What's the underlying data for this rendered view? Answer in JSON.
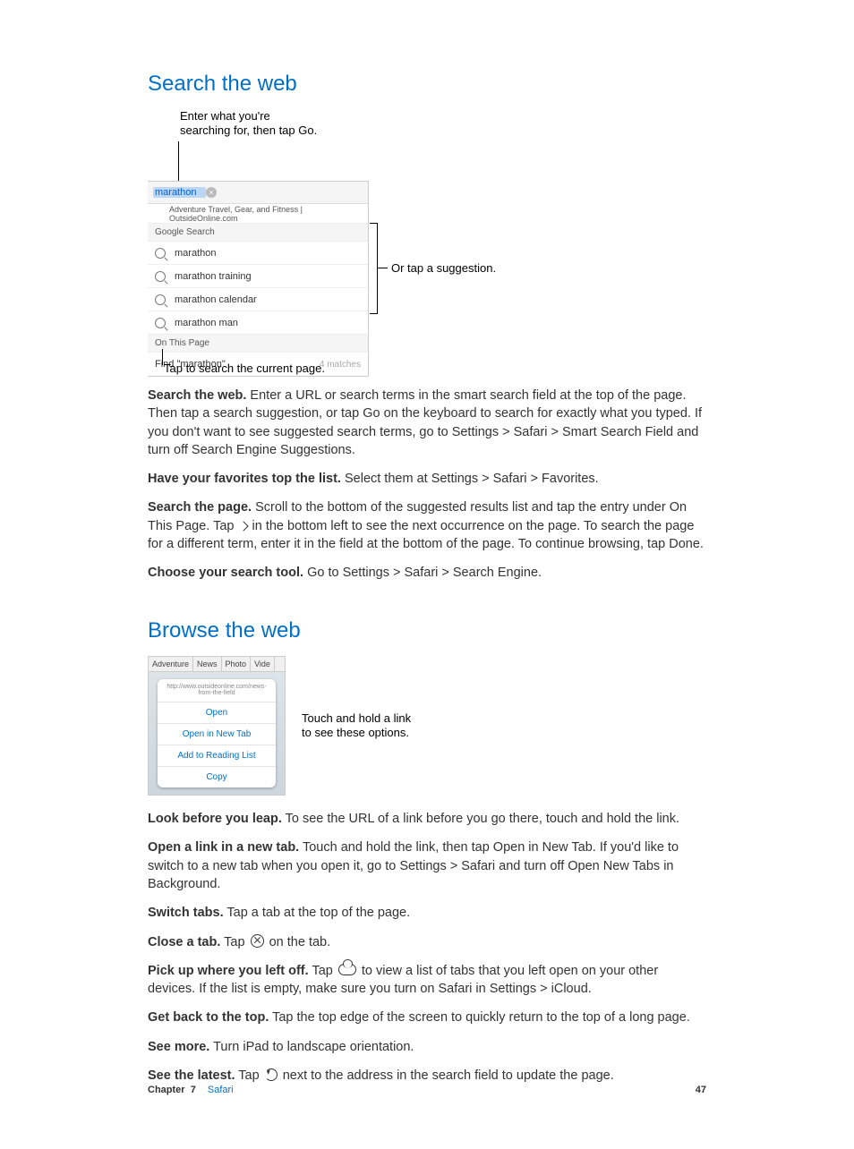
{
  "sections": {
    "search_title": "Search the web",
    "browse_title": "Browse the web"
  },
  "fig1": {
    "callout_top": "Enter what you're searching for, then tap Go.",
    "callout_right": "Or tap a suggestion.",
    "callout_bottom": "Tap to search the current page.",
    "search_value": "marathon",
    "top_hit": "Adventure Travel, Gear, and Fitness | OutsideOnline.com",
    "google_header": "Google Search",
    "suggestions": [
      "marathon",
      "marathon training",
      "marathon calendar",
      "marathon man"
    ],
    "onpage_header": "On This Page",
    "find_label": "Find \"marathon\"",
    "matches": "4 matches"
  },
  "body1": {
    "p1_lead": "Search the web.",
    "p1_rest": " Enter a URL or search terms in the smart search field at the top of the page. Then tap a search suggestion, or tap Go on the keyboard to search for exactly what you typed. If you don't want to see suggested search terms, go to Settings > Safari > Smart Search Field and turn off Search Engine Suggestions.",
    "p2_lead": "Have your favorites top the list.",
    "p2_rest": " Select them at Settings > Safari > Favorites.",
    "p3_lead": "Search the page.",
    "p3_rest_a": " Scroll to the bottom of the suggested results list and tap the entry under On This Page. Tap ",
    "p3_rest_b": " in the bottom left to see the next occurrence on the page. To search the page for a different term, enter it in the field at the bottom of the page. To continue browsing, tap Done.",
    "p4_lead": "Choose your search tool.",
    "p4_rest": " Go to Settings > Safari > Search Engine."
  },
  "fig2": {
    "tabs": [
      "Adventure",
      "News",
      "Photo",
      "Vide"
    ],
    "url": "http://www.outsideonline.com/news-from-the-field",
    "options": [
      "Open",
      "Open in New Tab",
      "Add to Reading List",
      "Copy"
    ],
    "callout": "Touch and hold a link to see these options."
  },
  "body2": {
    "p1_lead": "Look before you leap.",
    "p1_rest": " To see the URL of a link before you go there, touch and hold the link.",
    "p2_lead": "Open a link in a new tab.",
    "p2_rest": " Touch and hold the link, then tap Open in New Tab. If you'd like to switch to a new tab when you open it, go to Settings > Safari and turn off Open New Tabs in Background.",
    "p3_lead": "Switch tabs.",
    "p3_rest": " Tap a tab at the top of the page.",
    "p4_lead": "Close a tab.",
    "p4_rest_a": " Tap ",
    "p4_rest_b": " on the tab.",
    "p5_lead": "Pick up where you left off.",
    "p5_rest_a": " Tap ",
    "p5_rest_b": " to view a list of tabs that you left open on your other devices. If the list is empty, make sure you turn on Safari in Settings > iCloud.",
    "p6_lead": "Get back to the top.",
    "p6_rest": " Tap the top edge of the screen to quickly return to the top of a long page.",
    "p7_lead": "See more.",
    "p7_rest": " Turn iPad to landscape orientation.",
    "p8_lead": "See the latest.",
    "p8_rest_a": " Tap ",
    "p8_rest_b": " next to the address in the search field to update the page."
  },
  "footer": {
    "chapter_word": "Chapter",
    "chapter_num": "7",
    "chapter_name": "Safari",
    "page": "47"
  }
}
